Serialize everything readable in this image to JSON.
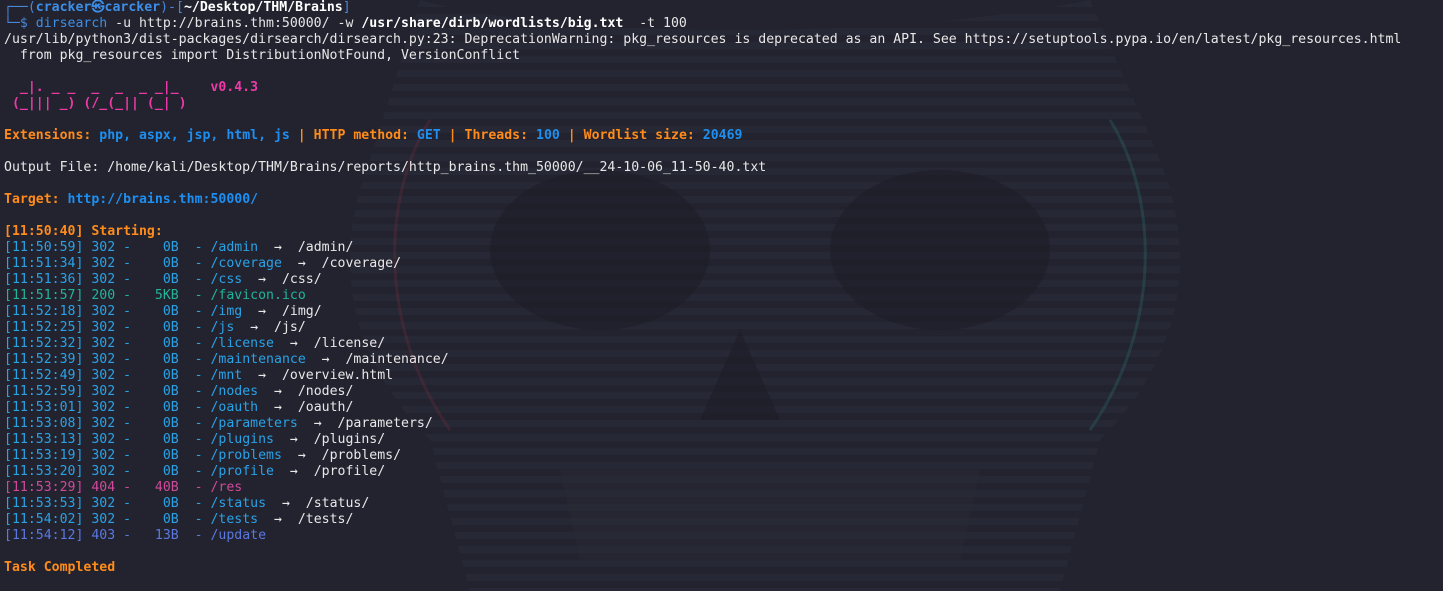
{
  "prompt": {
    "corner1": "┌──(",
    "user": "cracker㉿carcker",
    "mid": ")-[",
    "path": "~/Desktop/THM/Brains",
    "end": "]",
    "corner2": "└─$ ",
    "cmd": "dirsearch",
    "flag_u": " -u ",
    "url": "http://brains.thm:50000/",
    "flag_w": " -w ",
    "wordlist": "/usr/share/dirb/wordlists/big.txt",
    "flag_t": "  -t 100"
  },
  "warning": {
    "line1": "/usr/lib/python3/dist-packages/dirsearch/dirsearch.py:23: DeprecationWarning: pkg_resources is deprecated as an API. See https://setuptools.pypa.io/en/latest/pkg_resources.html",
    "line2": "  from pkg_resources import DistributionNotFound, VersionConflict"
  },
  "logo": {
    "row1": "  _|. _ _  _  _  _ _|_    v0.4.3",
    "row2": " (_||| _) (/_(_|| (_| )"
  },
  "config": {
    "ext_label": "Extensions: ",
    "ext_value": "php, aspx, jsp, html, js",
    "sep": " | ",
    "method_label": "HTTP method: ",
    "method_value": "GET",
    "threads_label": "Threads: ",
    "threads_value": "100",
    "wordlist_label": "Wordlist size: ",
    "wordlist_value": "20469"
  },
  "output_file": "Output File: /home/kali/Desktop/THM/Brains/reports/http_brains.thm_50000/__24-10-06_11-50-40.txt",
  "target": {
    "label": "Target: ",
    "value": "http://brains.thm:50000/"
  },
  "starting": "[11:50:40] Starting:",
  "results": [
    {
      "time": "[11:50:59]",
      "code": "302",
      "size": "0B",
      "path": "/admin",
      "redirect": "/admin/"
    },
    {
      "time": "[11:51:34]",
      "code": "302",
      "size": "0B",
      "path": "/coverage",
      "redirect": "/coverage/"
    },
    {
      "time": "[11:51:36]",
      "code": "302",
      "size": "0B",
      "path": "/css",
      "redirect": "/css/"
    },
    {
      "time": "[11:51:57]",
      "code": "200",
      "size": "5KB",
      "path": "/favicon.ico",
      "redirect": ""
    },
    {
      "time": "[11:52:18]",
      "code": "302",
      "size": "0B",
      "path": "/img",
      "redirect": "/img/"
    },
    {
      "time": "[11:52:25]",
      "code": "302",
      "size": "0B",
      "path": "/js",
      "redirect": "/js/"
    },
    {
      "time": "[11:52:32]",
      "code": "302",
      "size": "0B",
      "path": "/license",
      "redirect": "/license/"
    },
    {
      "time": "[11:52:39]",
      "code": "302",
      "size": "0B",
      "path": "/maintenance",
      "redirect": "/maintenance/"
    },
    {
      "time": "[11:52:49]",
      "code": "302",
      "size": "0B",
      "path": "/mnt",
      "redirect": "/overview.html"
    },
    {
      "time": "[11:52:59]",
      "code": "302",
      "size": "0B",
      "path": "/nodes",
      "redirect": "/nodes/"
    },
    {
      "time": "[11:53:01]",
      "code": "302",
      "size": "0B",
      "path": "/oauth",
      "redirect": "/oauth/"
    },
    {
      "time": "[11:53:08]",
      "code": "302",
      "size": "0B",
      "path": "/parameters",
      "redirect": "/parameters/"
    },
    {
      "time": "[11:53:13]",
      "code": "302",
      "size": "0B",
      "path": "/plugins",
      "redirect": "/plugins/"
    },
    {
      "time": "[11:53:19]",
      "code": "302",
      "size": "0B",
      "path": "/problems",
      "redirect": "/problems/"
    },
    {
      "time": "[11:53:20]",
      "code": "302",
      "size": "0B",
      "path": "/profile",
      "redirect": "/profile/"
    },
    {
      "time": "[11:53:29]",
      "code": "404",
      "size": "40B",
      "path": "/res",
      "redirect": ""
    },
    {
      "time": "[11:53:53]",
      "code": "302",
      "size": "0B",
      "path": "/status",
      "redirect": "/status/"
    },
    {
      "time": "[11:54:02]",
      "code": "302",
      "size": "0B",
      "path": "/tests",
      "redirect": "/tests/"
    },
    {
      "time": "[11:54:12]",
      "code": "403",
      "size": "13B",
      "path": "/update",
      "redirect": ""
    }
  ],
  "arrow": "->",
  "completed": "Task Completed",
  "colors": {
    "background": "#22232f",
    "prompt": "#3d8ee6",
    "logo": "#ee3aa8",
    "orange": "#ff8c1a",
    "blue": "#1e8ff0",
    "status_302": "#2aa2e6",
    "status_200": "#23b39b",
    "status_404": "#d04a9a",
    "status_403": "#5a78e0"
  }
}
